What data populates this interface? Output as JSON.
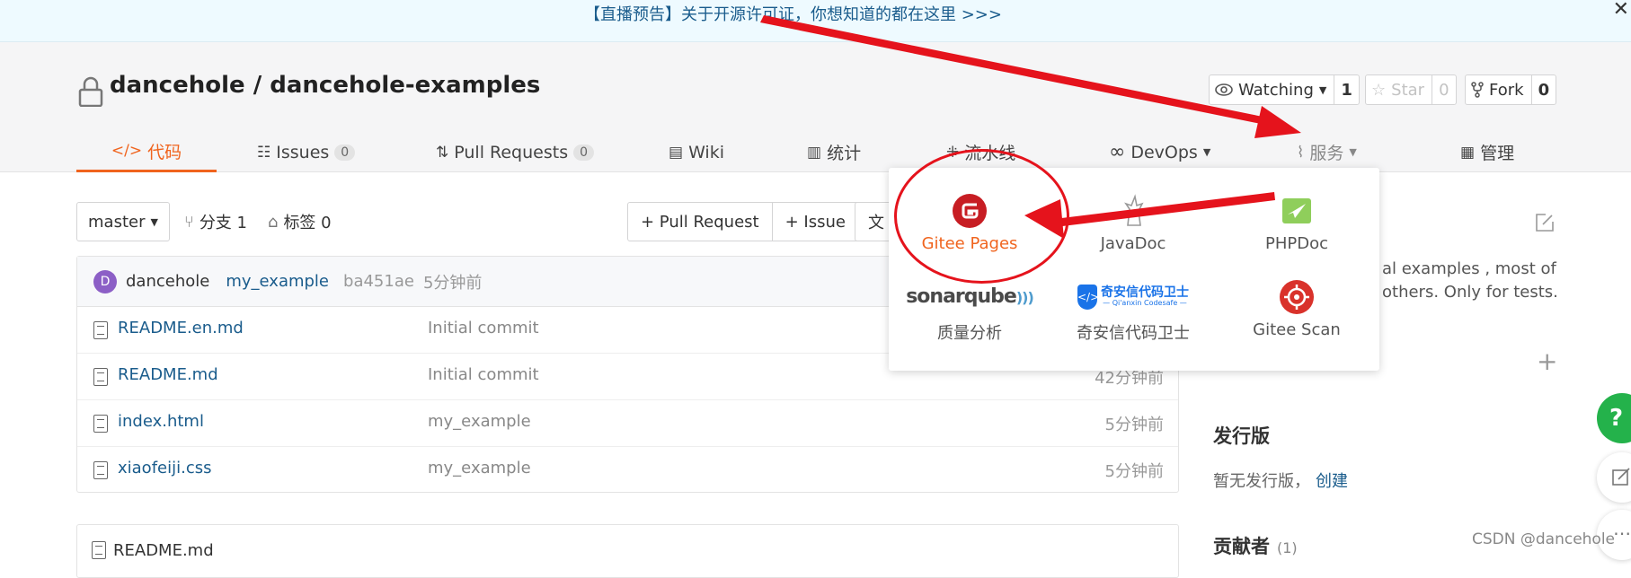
{
  "banner": {
    "text": "【直播预告】关于开源许可证，你想知道的都在这里 >>>",
    "close": "✕"
  },
  "repo": {
    "owner": "dancehole",
    "separator": " / ",
    "name": "dancehole-examples"
  },
  "actions": {
    "watch": {
      "label": "Watching",
      "count": "1"
    },
    "star": {
      "label": "Star",
      "count": "0"
    },
    "fork": {
      "label": "Fork",
      "count": "0"
    }
  },
  "tabs": {
    "code": "代码",
    "issues": "Issues",
    "issues_count": "0",
    "pulls": "Pull Requests",
    "pulls_count": "0",
    "wiki": "Wiki",
    "stats": "统计",
    "pipeline": "流水线",
    "devops": "DevOps",
    "services": "服务",
    "manage": "管理"
  },
  "toolbar": {
    "branch": "master",
    "branches": "分支 1",
    "tags": "标签 0",
    "new_pr": "+ Pull Request",
    "new_issue": "+ Issue",
    "file_btn_partial": "文"
  },
  "commit": {
    "avatar_letter": "D",
    "author": "dancehole",
    "message": "my_example",
    "sha": "ba451ae",
    "time": "5分钟前"
  },
  "files": [
    {
      "name": "README.en.md",
      "message": "Initial commit",
      "time": ""
    },
    {
      "name": "README.md",
      "message": "Initial commit",
      "time": "42分钟前"
    },
    {
      "name": "index.html",
      "message": "my_example",
      "time": "5分钟前"
    },
    {
      "name": "xiaofeiji.css",
      "message": "my_example",
      "time": "5分钟前"
    }
  ],
  "readme_header": "README.md",
  "sidebar": {
    "desc_line1": "al examples , most of",
    "desc_line2": "others. Only for tests.",
    "releases_title": "发行版",
    "releases_empty": "暂无发行版，",
    "releases_create": "创建",
    "contributors_title": "贡献者",
    "contributors_count": "(1)"
  },
  "services_menu": [
    {
      "label": "Gitee Pages",
      "icon": "gitee-pages-icon",
      "color": "#f0641e"
    },
    {
      "label": "JavaDoc",
      "icon": "javadoc-icon"
    },
    {
      "label": "PHPDoc",
      "icon": "phpdoc-icon"
    },
    {
      "label": "质量分析",
      "icon": "sonarqube-logo",
      "logo_text": "sonarqube"
    },
    {
      "label": "奇安信代码卫士",
      "icon": "qianxin-logo",
      "logo_text": "奇安信代码卫士",
      "logo_sub": "— Qi'anxin Codesafe —"
    },
    {
      "label": "Gitee Scan",
      "icon": "gitee-scan-icon"
    }
  ],
  "help_button": "?",
  "watermark": "CSDN @dancehole",
  "colors": {
    "accent": "#f0641e",
    "link": "#1a5c8c",
    "annotation": "#e5131c",
    "help": "#24b24b"
  }
}
